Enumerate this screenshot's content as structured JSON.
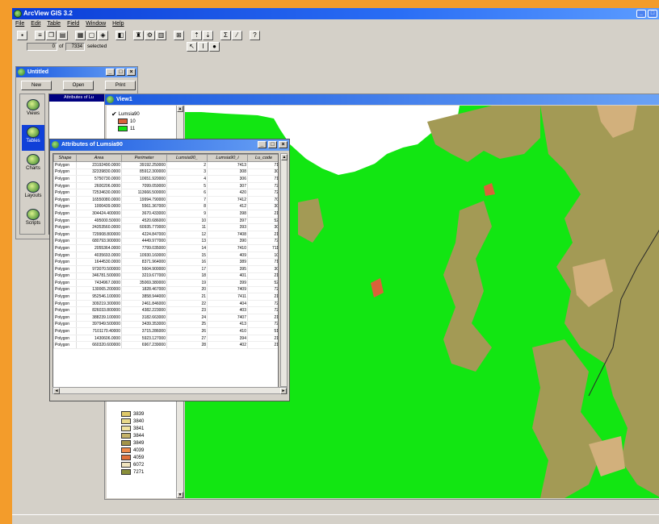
{
  "app": {
    "title": "ArcView GIS 3.2",
    "menu": [
      "File",
      "Edit",
      "Table",
      "Field",
      "Window",
      "Help"
    ],
    "selection": {
      "selected_count": "0",
      "of_label": "of",
      "total": "7334",
      "selected_label": "selected"
    }
  },
  "project": {
    "title": "Untitled",
    "buttons": {
      "new": "New",
      "open": "Open",
      "print": "Print"
    },
    "sidebar": [
      {
        "label": "Views"
      },
      {
        "label": "Tables"
      },
      {
        "label": "Charts"
      },
      {
        "label": "Layouts"
      },
      {
        "label": "Scripts"
      }
    ],
    "list_header": "Attributes of Lu"
  },
  "view": {
    "title": "View1",
    "legend": {
      "theme_name": "Lumsia90",
      "top_items": [
        {
          "label": "10",
          "color": "#d9623a"
        },
        {
          "label": "11",
          "color": "#12e612"
        }
      ],
      "items": [
        {
          "label": "3839",
          "color": "#e0c96a"
        },
        {
          "label": "3840",
          "color": "#e8d98a"
        },
        {
          "label": "3841",
          "color": "#f0e3a0"
        },
        {
          "label": "3844",
          "color": "#c5b36a"
        },
        {
          "label": "3849",
          "color": "#a39448"
        },
        {
          "label": "4039",
          "color": "#f08a4a"
        },
        {
          "label": "4059",
          "color": "#e0703a"
        },
        {
          "label": "6072",
          "color": "#f2e6c0"
        },
        {
          "label": "7271",
          "color": "#8a8f3a"
        }
      ]
    }
  },
  "attributes": {
    "title": "Attributes of Lumsia90",
    "columns": [
      "Shape",
      "Area",
      "Perimeter",
      "Lumsia90_",
      "Lumsia90_i",
      "Lu_code"
    ],
    "rows": [
      [
        "Polygon",
        "23192490.0000",
        "39192.250000",
        "2",
        "7413",
        "71"
      ],
      [
        "Polygon",
        "32339830.0000",
        "85912.300000",
        "3",
        "308",
        "30"
      ],
      [
        "Polygon",
        "5750730.0000",
        "10651.920000",
        "4",
        "306",
        "71"
      ],
      [
        "Polygon",
        "2600206.0000",
        "7099.059000",
        "5",
        "307",
        "72"
      ],
      [
        "Polygon",
        "72534630.0000",
        "113666.500000",
        "6",
        "420",
        "72"
      ],
      [
        "Polygon",
        "16550080.0000",
        "19994.790000",
        "7",
        "7412",
        "70"
      ],
      [
        "Polygon",
        "1000439.0000",
        "5561.367000",
        "8",
        "412",
        "30"
      ],
      [
        "Polygon",
        "304424.400000",
        "3670.433000",
        "9",
        "398",
        "21"
      ],
      [
        "Polygon",
        "495000.50000",
        "4520.686000",
        "10",
        "397",
        "52"
      ],
      [
        "Polygon",
        "24353560.0000",
        "60935.770000",
        "11",
        "393",
        "30"
      ],
      [
        "Polygon",
        "729908.800000",
        "4224.847000",
        "12",
        "7408",
        "21"
      ],
      [
        "Polygon",
        "680793.900000",
        "4449.977000",
        "13",
        "390",
        "72"
      ],
      [
        "Polygon",
        "2055364.0000",
        "7799.035000",
        "14",
        "7410",
        "711"
      ],
      [
        "Polygon",
        "4035693.0000",
        "10930.160000",
        "15",
        "409",
        "10"
      ],
      [
        "Polygon",
        "1644530.0000",
        "8371.964000",
        "16",
        "389",
        "71"
      ],
      [
        "Polygon",
        "973070.500000",
        "5604.900000",
        "17",
        "395",
        "30"
      ],
      [
        "Polygon",
        "346781.500000",
        "3219.677000",
        "18",
        "401",
        "21"
      ],
      [
        "Polygon",
        "7434967.0000",
        "35069.380000",
        "19",
        "399",
        "52"
      ],
      [
        "Polygon",
        "130065.200000",
        "1828.467000",
        "20",
        "7409",
        "72"
      ],
      [
        "Polygon",
        "952546.100000",
        "3858.944000",
        "21",
        "7411",
        "21"
      ],
      [
        "Polygon",
        "309219.300000",
        "2461.846000",
        "22",
        "404",
        "72"
      ],
      [
        "Polygon",
        "826033.800000",
        "4382.223000",
        "23",
        "403",
        "72"
      ],
      [
        "Polygon",
        "388239.100000",
        "3182.663000",
        "24",
        "7407",
        "21"
      ],
      [
        "Polygon",
        "397949.500000",
        "3439.353000",
        "25",
        "413",
        "72"
      ],
      [
        "Polygon",
        "7101170.40000",
        "3715.286000",
        "26",
        "410",
        "51"
      ],
      [
        "Polygon",
        "1430606.0000",
        "5923.127000",
        "27",
        "394",
        "21"
      ],
      [
        "Polygon",
        "660320.600000",
        "6967.239000",
        "28",
        "402",
        "21"
      ]
    ]
  },
  "colors": {
    "green_landuse": "#12e612",
    "olive_landuse": "#a39a55",
    "tan_landuse": "#d2b07c",
    "titlebar_blue": "#0a3cd6",
    "desktop_orange": "#f39c2b"
  }
}
